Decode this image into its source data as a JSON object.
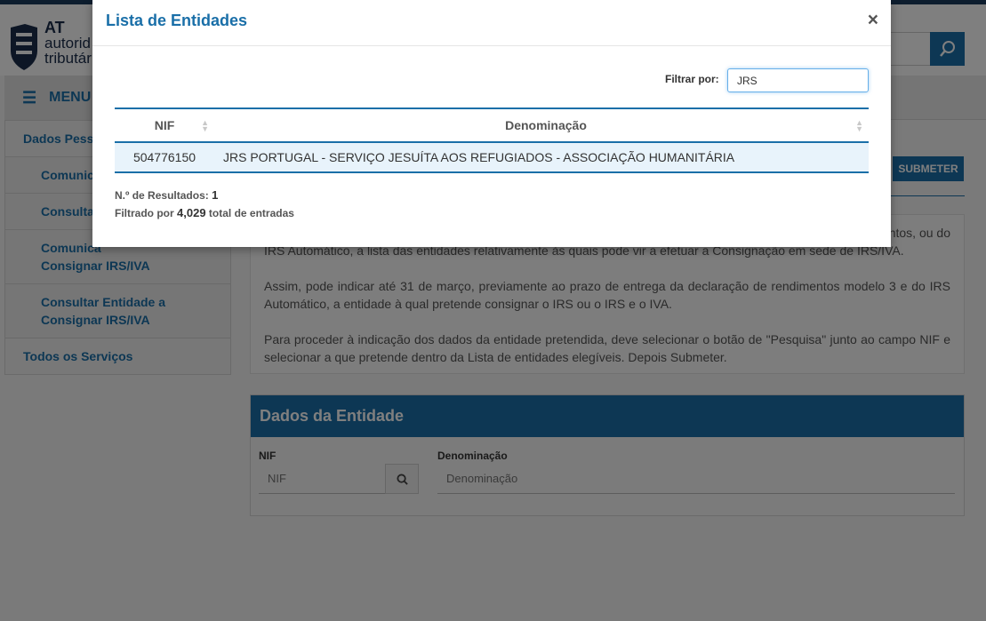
{
  "brand": {
    "line1": "AT",
    "line2": "autorid",
    "line3": "tributár"
  },
  "menu": {
    "label": "MENU"
  },
  "sidebar": {
    "items": [
      {
        "label": "Dados Pesso"
      },
      {
        "label": "Comunica"
      },
      {
        "label": "Consultar"
      },
      {
        "label": "Comunica",
        "label2": "Consignar IRS/IVA"
      },
      {
        "label": "Consultar Entidade a",
        "label2": "Consignar IRS/IVA"
      },
      {
        "label": "Todos os Serviços"
      }
    ]
  },
  "page": {
    "submit_label": "SUBMETER",
    "info": {
      "p1_line1": "ntos, ou do",
      "p1_line2": "IRS Automático, a lista das entidades relativamente às quais pode vir a efetuar a Consignação em sede de IRS/IVA.",
      "p2": "Assim, pode indicar até 31 de março, previamente ao prazo de entrega da declaração de rendimentos modelo 3 e do IRS Automático, a entidade à qual pretende consignar o IRS ou o IRS e o IVA.",
      "p3": "Para proceder à indicação dos dados da entidade pretendida, deve selecionar o botão de \"Pesquisa\" junto ao campo NIF e selecionar a que pretende dentro da Lista de entidades elegíveis. Depois Submeter."
    },
    "entity_panel": {
      "title": "Dados da Entidade",
      "nif_label": "NIF",
      "nif_placeholder": "NIF",
      "den_label": "Denominação",
      "den_placeholder": "Denominação"
    }
  },
  "modal": {
    "title": "Lista de Entidades",
    "close": "×",
    "filter_label": "Filtrar por:",
    "filter_value": "JRS",
    "columns": [
      "NIF",
      "Denominação"
    ],
    "rows": [
      {
        "nif": "504776150",
        "den": "JRS PORTUGAL - SERVIÇO JESUÍTA AOS REFUGIADOS - ASSOCIAÇÃO HUMANITÁRIA"
      }
    ],
    "results_label": "N.º de Resultados:",
    "results_count": "1",
    "filtered_prefix": "Filtrado por",
    "filtered_total": "4,029",
    "filtered_suffix": "total de entradas"
  },
  "colors": {
    "primary": "#1a6fa8",
    "navy": "#1b3a5c",
    "row_highlight": "#e8f3fb"
  }
}
